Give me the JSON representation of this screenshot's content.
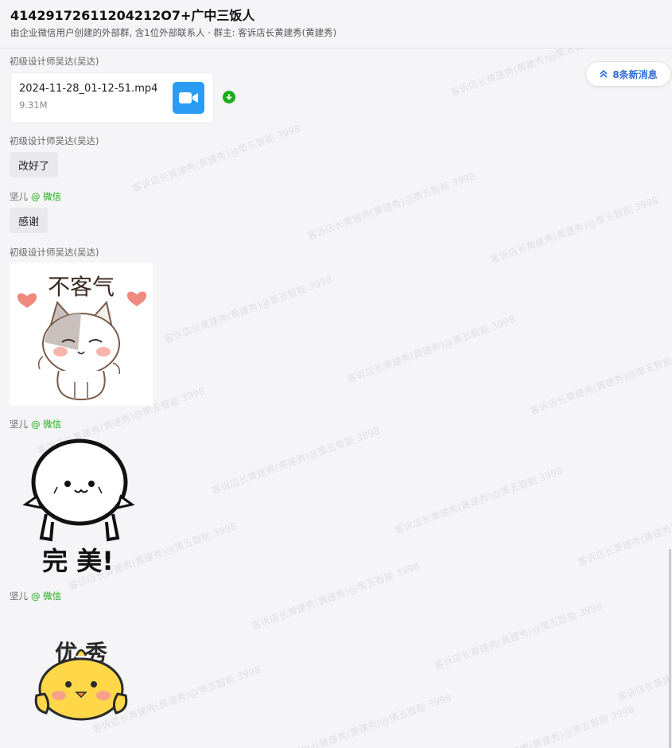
{
  "header": {
    "title": "41429172611204212О7+广中三饭人",
    "subtitle": "由企业微信用户创建的外部群, 含1位外部联系人 · 群主: 客诉店长黄建秀(黄建秀)"
  },
  "new_messages_badge": {
    "label": "8条新消息",
    "icon": "double-chevron-up-icon"
  },
  "messages": [
    {
      "sender": "初级设计师吴达(吴达)",
      "type": "file",
      "file_name": "2024-11-28_01-12-51.mp4",
      "file_size": "9.31M",
      "icon": "video-camera-icon",
      "action_icon": "download-icon"
    },
    {
      "sender": "初级设计师吴达(吴达)",
      "type": "text",
      "text": "改好了"
    },
    {
      "sender": "坚儿",
      "sender_source": "@ 微信",
      "type": "text",
      "text": "感谢"
    },
    {
      "sender": "初级设计师吴达(吴达)",
      "type": "sticker",
      "sticker_text": "不客气",
      "icon": "cat-sticker"
    },
    {
      "sender": "坚儿",
      "sender_source": "@ 微信",
      "type": "sticker",
      "sticker_text": "完 美!",
      "icon": "round-face-sticker"
    },
    {
      "sender": "坚儿",
      "sender_source": "@ 微信",
      "type": "sticker",
      "sticker_text": "优 秀",
      "icon": "chick-sticker"
    }
  ],
  "watermark": "客诉店长黄建秀(黄建秀)@策五智能 3998",
  "colors": {
    "accent": "#2f6bd8",
    "wechat_green": "#1aad19",
    "file_icon_blue": "#2a9cf3",
    "background": "#f5f5f7"
  }
}
